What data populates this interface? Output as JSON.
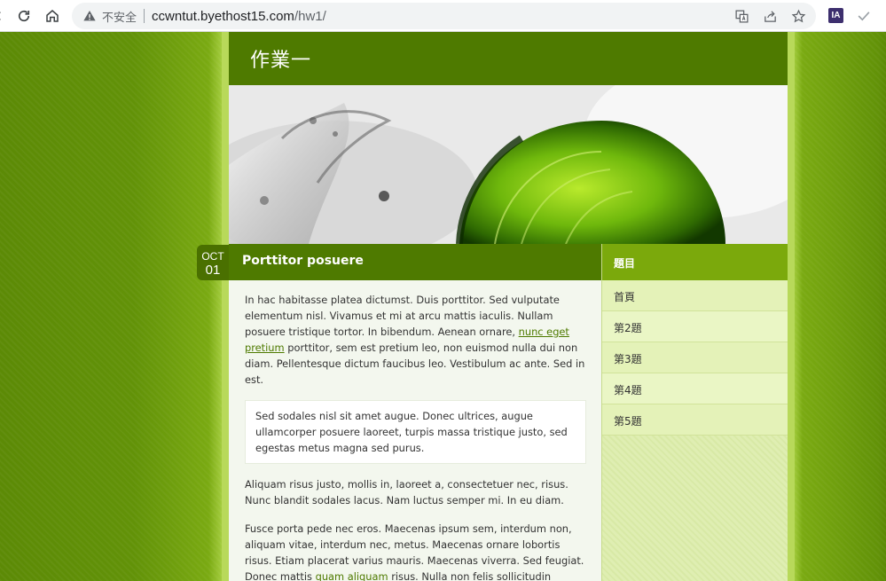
{
  "browser": {
    "security_text": "不安全",
    "url_host": "ccwntut.byethost15.com",
    "url_path": "/hw1/",
    "extension_label": "IA"
  },
  "site": {
    "title": "作業一"
  },
  "post": {
    "date_month": "OCT",
    "date_day": "01",
    "title": "Porttitor posuere",
    "p1_before": "In hac habitasse platea dictumst. Duis porttitor. Sed vulputate elementum nisl. Vivamus et mi at arcu mattis iaculis. Nullam posuere tristique tortor. In bibendum. Aenean ornare, ",
    "p1_link": "nunc eget pretium",
    "p1_after": " porttitor, sem est pretium leo, non euismod nulla dui non diam. Pellentesque dictum faucibus leo. Vestibulum ac ante. Sed in est.",
    "quote": "Sed sodales nisl sit amet augue. Donec ultrices, augue ullamcorper posuere laoreet, turpis massa tristique justo, sed egestas metus magna sed purus.",
    "p2": "Aliquam risus justo, mollis in, laoreet a, consectetuer nec, risus. Nunc blandit sodales lacus. Nam luctus semper mi. In eu diam.",
    "p3_before": "Fusce porta pede nec eros. Maecenas ipsum sem, interdum non, aliquam vitae, interdum nec, metus. Maecenas ornare lobortis risus. Etiam placerat varius mauris. Maecenas viverra. Sed feugiat. Donec mattis ",
    "p3_link": "quam aliquam",
    "p3_after": " risus. Nulla non felis sollicitudin"
  },
  "sidebar": {
    "heading": "題目",
    "items": [
      {
        "label": "首頁"
      },
      {
        "label": "第2題"
      },
      {
        "label": "第3題"
      },
      {
        "label": "第4題"
      },
      {
        "label": "第5題"
      }
    ]
  },
  "colors": {
    "header_green": "#4e7a00",
    "sidebar_head": "#7ba90c",
    "link": "#4e7a00"
  }
}
